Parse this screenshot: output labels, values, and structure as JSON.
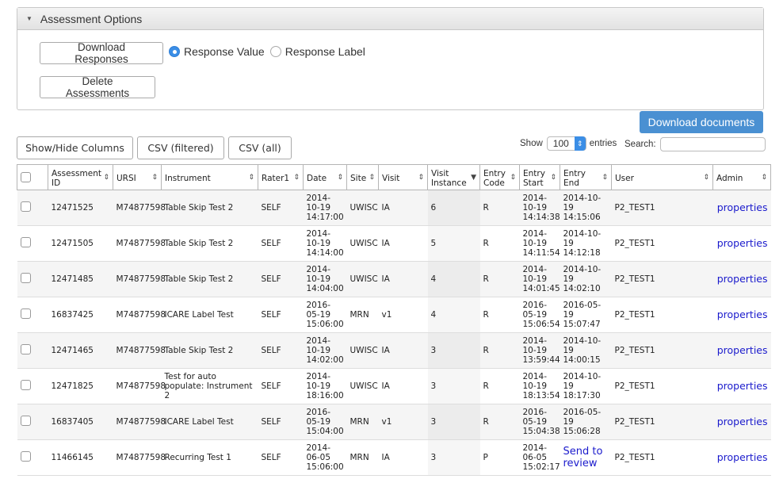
{
  "options_panel": {
    "title": "Assessment Options",
    "download_responses_label": "Download Responses",
    "radio_options": [
      {
        "label": "Response Value",
        "checked": true
      },
      {
        "label": "Response Label",
        "checked": false
      }
    ],
    "delete_label": "Delete Assessments"
  },
  "toolbar": {
    "download_documents_label": "Download documents",
    "show_hide_label": "Show/Hide Columns",
    "csv_filtered_label": "CSV (filtered)",
    "csv_all_label": "CSV (all)",
    "show_label": "Show",
    "entries_value": "100",
    "entries_label": "entries",
    "search_label": "Search:",
    "search_value": ""
  },
  "table": {
    "columns": [
      {
        "label": "",
        "sort": "none"
      },
      {
        "label": "Assessment ID",
        "sort": "both"
      },
      {
        "label": "URSI",
        "sort": "both"
      },
      {
        "label": "Instrument",
        "sort": "both"
      },
      {
        "label": "Rater1",
        "sort": "both"
      },
      {
        "label": "Date",
        "sort": "both"
      },
      {
        "label": "Site",
        "sort": "both"
      },
      {
        "label": "Visit",
        "sort": "both"
      },
      {
        "label": "Visit Instance",
        "sort": "desc"
      },
      {
        "label": "Entry Code",
        "sort": "both"
      },
      {
        "label": "Entry Start",
        "sort": "both"
      },
      {
        "label": "Entry End",
        "sort": "both"
      },
      {
        "label": "User",
        "sort": "both"
      },
      {
        "label": "Admin",
        "sort": "both"
      }
    ],
    "rows": [
      {
        "id": "12471525",
        "ursi": "M74877598",
        "instrument": "Table Skip Test 2",
        "rater": "SELF",
        "date": "2014-10-19 14:17:00",
        "site": "UWISC",
        "visit": "IA",
        "instance": "6",
        "code": "R",
        "start": "2014-10-19 14:14:38",
        "end": "2014-10-19 14:15:06",
        "user": "P2_TEST1",
        "admin": "properties"
      },
      {
        "id": "12471505",
        "ursi": "M74877598",
        "instrument": "Table Skip Test 2",
        "rater": "SELF",
        "date": "2014-10-19 14:14:00",
        "site": "UWISC",
        "visit": "IA",
        "instance": "5",
        "code": "R",
        "start": "2014-10-19 14:11:54",
        "end": "2014-10-19 14:12:18",
        "user": "P2_TEST1",
        "admin": "properties"
      },
      {
        "id": "12471485",
        "ursi": "M74877598",
        "instrument": "Table Skip Test 2",
        "rater": "SELF",
        "date": "2014-10-19 14:04:00",
        "site": "UWISC",
        "visit": "IA",
        "instance": "4",
        "code": "R",
        "start": "2014-10-19 14:01:45",
        "end": "2014-10-19 14:02:10",
        "user": "P2_TEST1",
        "admin": "properties"
      },
      {
        "id": "16837425",
        "ursi": "M74877598",
        "instrument": "ICARE Label Test",
        "rater": "SELF",
        "date": "2016-05-19 15:06:00",
        "site": "MRN",
        "visit": "v1",
        "instance": "4",
        "code": "R",
        "start": "2016-05-19 15:06:54",
        "end": "2016-05-19 15:07:47",
        "user": "P2_TEST1",
        "admin": "properties"
      },
      {
        "id": "12471465",
        "ursi": "M74877598",
        "instrument": "Table Skip Test 2",
        "rater": "SELF",
        "date": "2014-10-19 14:02:00",
        "site": "UWISC",
        "visit": "IA",
        "instance": "3",
        "code": "R",
        "start": "2014-10-19 13:59:44",
        "end": "2014-10-19 14:00:15",
        "user": "P2_TEST1",
        "admin": "properties"
      },
      {
        "id": "12471825",
        "ursi": "M74877598",
        "instrument": "Test for auto populate: Instrument 2",
        "rater": "SELF",
        "date": "2014-10-19 18:16:00",
        "site": "UWISC",
        "visit": "IA",
        "instance": "3",
        "code": "R",
        "start": "2014-10-19 18:13:54",
        "end": "2014-10-19 18:17:30",
        "user": "P2_TEST1",
        "admin": "properties"
      },
      {
        "id": "16837405",
        "ursi": "M74877598",
        "instrument": "ICARE Label Test",
        "rater": "SELF",
        "date": "2016-05-19 15:04:00",
        "site": "MRN",
        "visit": "v1",
        "instance": "3",
        "code": "R",
        "start": "2016-05-19 15:04:38",
        "end": "2016-05-19 15:06:28",
        "user": "P2_TEST1",
        "admin": "properties"
      },
      {
        "id": "11466145",
        "ursi": "M74877598",
        "instrument": "Recurring Test 1",
        "rater": "SELF",
        "date": "2014-06-05 15:06:00",
        "site": "MRN",
        "visit": "IA",
        "instance": "3",
        "code": "P",
        "start": "2014-06-05 15:02:17",
        "end": "Send to review",
        "end_is_link": true,
        "user": "P2_TEST1",
        "admin": "properties"
      }
    ]
  },
  "colors": {
    "primary_button": "#4a90d2",
    "link": "#1a1acc",
    "radio_checked": "#3b8ee6"
  }
}
